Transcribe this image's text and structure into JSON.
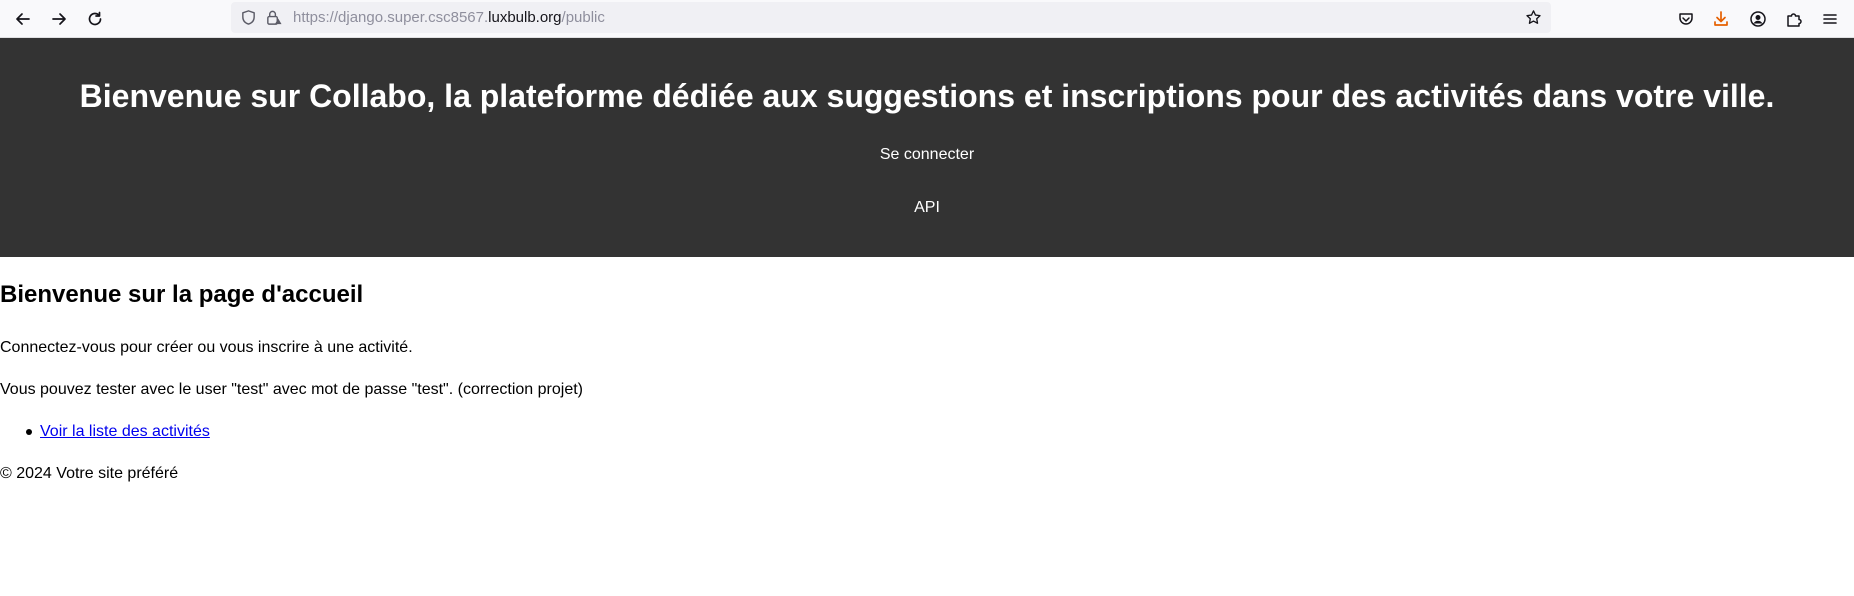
{
  "browser": {
    "url_prefix": "https://django.super.csc8567.",
    "url_host": "luxbulb.org",
    "url_path": "/public",
    "icons": {
      "back": "arrow-left-icon",
      "forward": "arrow-right-icon",
      "reload": "reload-icon",
      "shield": "shield-icon",
      "lock": "lock-warning-icon",
      "bookmark": "star-icon",
      "pocket": "pocket-icon",
      "downloads": "download-icon",
      "account": "account-icon",
      "extensions": "puzzle-icon",
      "menu": "hamburger-menu-icon"
    },
    "download_color": "#e66000"
  },
  "header": {
    "title": "Bienvenue sur Collabo, la plateforme dédiée aux suggestions et inscriptions pour des activités dans votre ville.",
    "nav": {
      "login": "Se connecter",
      "api": "API"
    },
    "background": "#333333"
  },
  "main": {
    "title": "Bienvenue sur la page d'accueil",
    "paragraph1": "Connectez-vous pour créer ou vous inscrire à une activité.",
    "paragraph2": "Vous pouvez tester avec le user \"test\" avec mot de passe \"test\". (correction projet)",
    "links": [
      {
        "label": "Voir la liste des activités"
      }
    ],
    "link_color": "#0000ee"
  },
  "footer": {
    "text": "© 2024 Votre site préféré"
  }
}
